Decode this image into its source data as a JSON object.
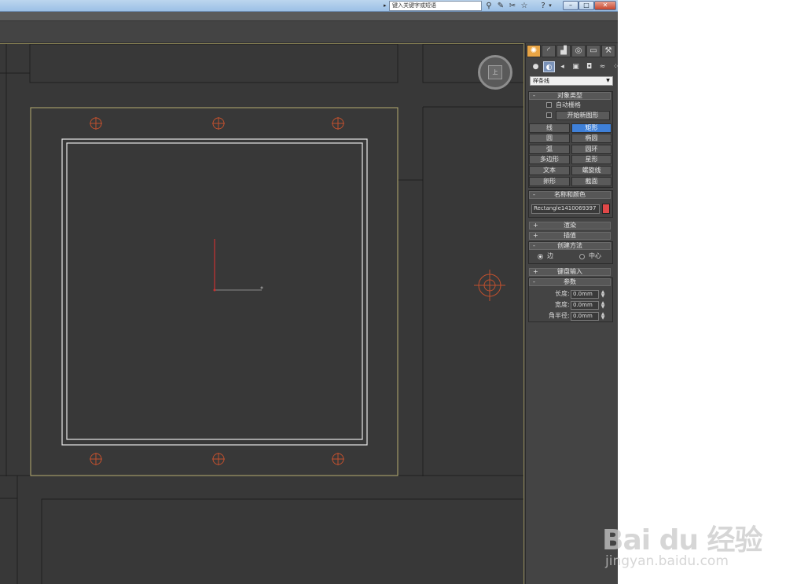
{
  "titlebar": {
    "search_placeholder": "键入关键字或短语",
    "icons": [
      "binoculars-icon",
      "wrench-icon",
      "tools-icon",
      "star-icon",
      "help-icon"
    ],
    "window_buttons": [
      "minimize",
      "maximize",
      "close"
    ]
  },
  "command_panel": {
    "tabs": [
      "create",
      "modify",
      "hierarchy",
      "motion",
      "display",
      "utilities"
    ],
    "subtabs": [
      "geometry",
      "shapes",
      "lights",
      "cameras",
      "helpers",
      "space-warps",
      "systems"
    ],
    "category": "样条线",
    "object_type": {
      "header": "对象类型",
      "autogrid_label": "自动栅格",
      "start_new_shape_label": "开始新图形",
      "buttons": [
        [
          "线",
          "矩形"
        ],
        [
          "圆",
          "椭圆"
        ],
        [
          "弧",
          "圆环"
        ],
        [
          "多边形",
          "星形"
        ],
        [
          "文本",
          "螺旋线"
        ],
        [
          "卵形",
          "截面"
        ]
      ],
      "selected": "矩形"
    },
    "name_color": {
      "header": "名称和颜色",
      "name": "Rectangle1410069397",
      "color": "#e04848"
    },
    "rollouts_collapsed": [
      {
        "sign": "+",
        "label": "渲染"
      },
      {
        "sign": "+",
        "label": "插值"
      }
    ],
    "creation_method": {
      "header": "创建方法",
      "sign": "-",
      "options": [
        "边",
        "中心"
      ],
      "selected": "边"
    },
    "keyboard_entry": {
      "sign": "+",
      "label": "键盘输入"
    },
    "parameters": {
      "header": "参数",
      "sign": "-",
      "fields": [
        {
          "label": "长度:",
          "value": "0.0mm"
        },
        {
          "label": "宽度:",
          "value": "0.0mm"
        },
        {
          "label": "角半径:",
          "value": "0.0mm"
        }
      ]
    }
  },
  "viewport": {
    "viewcube_label": "上"
  },
  "watermark": {
    "logo": "Bai du 经验",
    "url": "jingyan.baidu.com"
  }
}
